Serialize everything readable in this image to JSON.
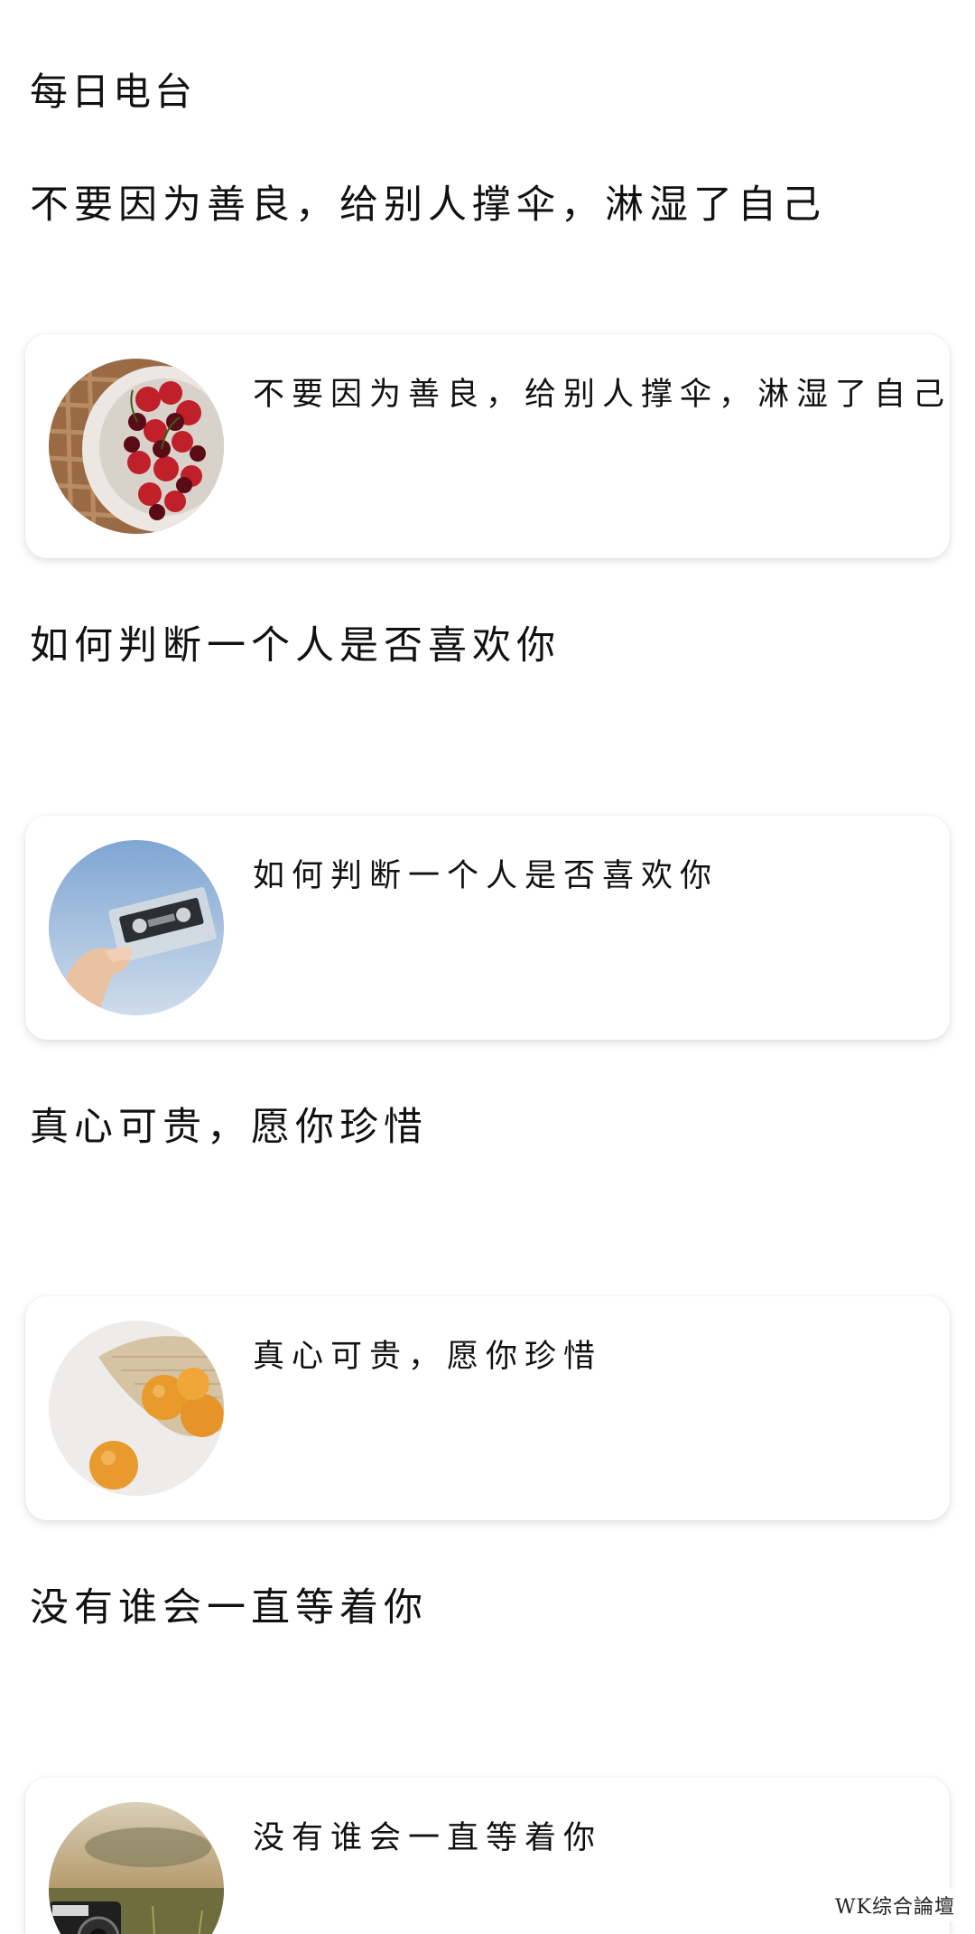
{
  "header": {
    "title": "每日电台"
  },
  "sections": [
    {
      "title": "不要因为善良，给别人撑伞，淋湿了自己",
      "card_text": "不要因为善良，给别人撑伞，淋湿了自己",
      "image": "cherries-bowl-image"
    },
    {
      "title": "如何判断一个人是否喜欢你",
      "card_text": "如何判断一个人是否喜欢你",
      "image": "cassette-tape-image"
    },
    {
      "title": "真心可贵，愿你珍惜",
      "card_text": "真心可贵，愿你珍惜",
      "image": "apricots-image"
    },
    {
      "title": "没有谁会一直等着你",
      "card_text": "没有谁会一直等着你",
      "image": "camera-field-image"
    }
  ],
  "watermark": "WK综合論壇"
}
